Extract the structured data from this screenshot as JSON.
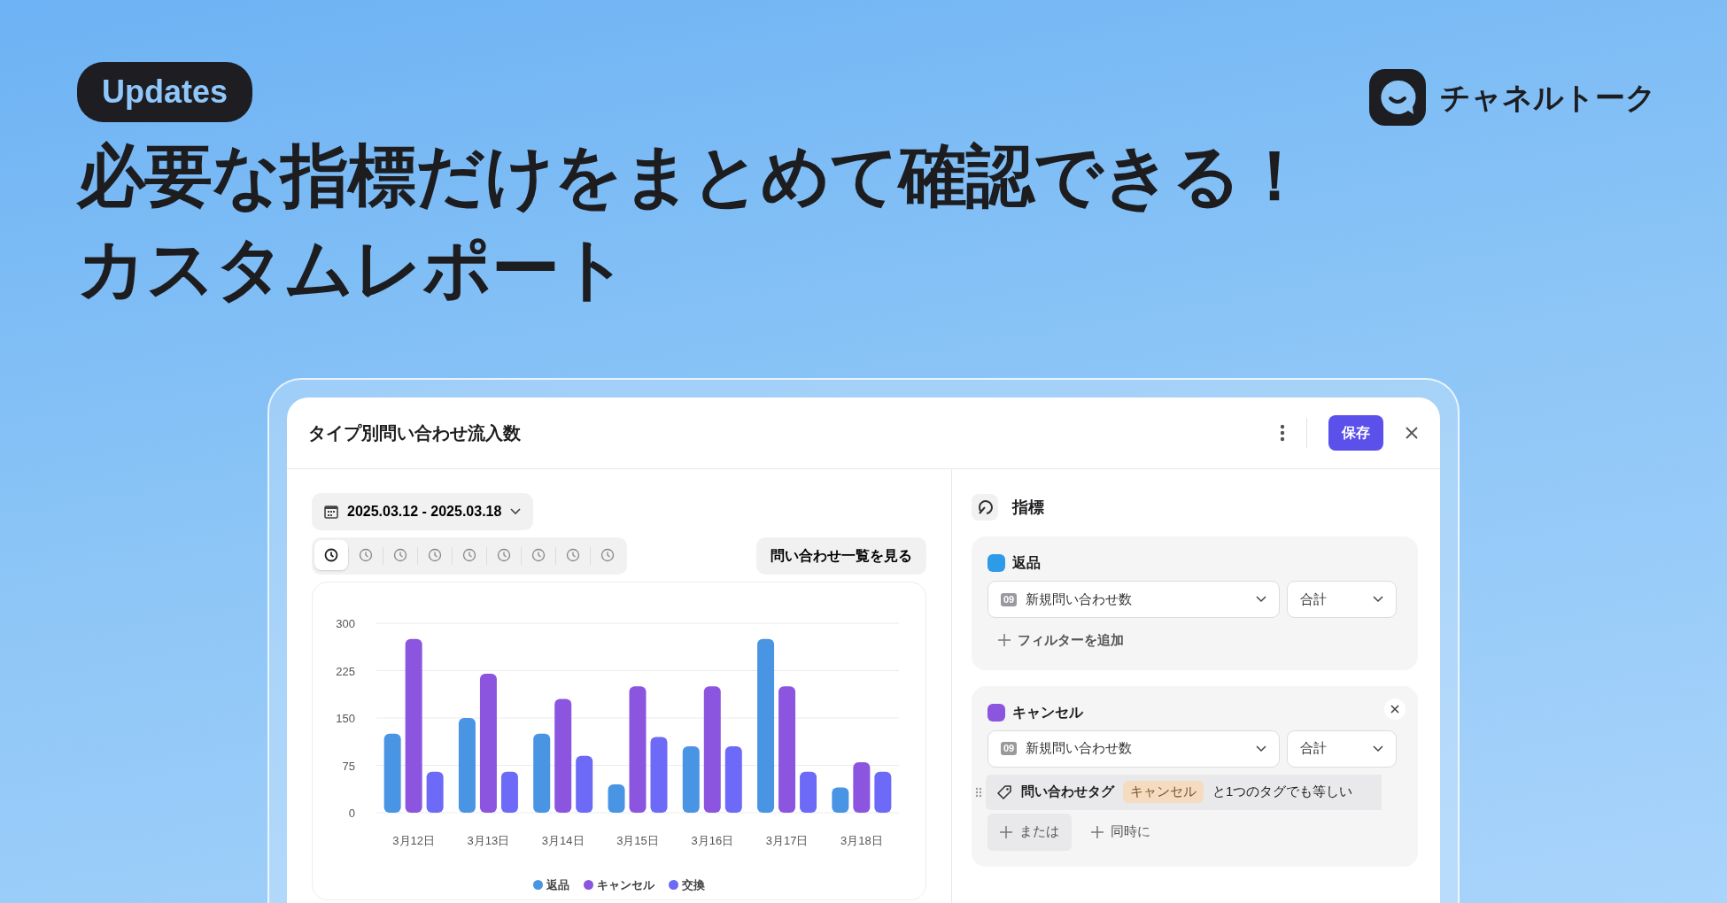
{
  "badge": "Updates",
  "headline": [
    "必要な指標だけをまとめて確認できる！",
    "カスタムレポート"
  ],
  "logo": {
    "text": "チャネルトーク"
  },
  "report": {
    "title": "タイプ別問い合わせ流入数",
    "save_button": "保存",
    "date_range": "2025.03.12 - 2025.03.18",
    "time_buttons": [
      {
        "selected": true
      },
      {
        "selected": false
      },
      {
        "selected": false
      },
      {
        "selected": false
      },
      {
        "selected": false
      },
      {
        "selected": false
      },
      {
        "selected": false
      },
      {
        "selected": false
      },
      {
        "selected": false
      }
    ],
    "list_button": "問い合わせ一覧を見る",
    "chart_data": {
      "type": "bar",
      "categories": [
        "3月12日",
        "3月13日",
        "3月14日",
        "3月15日",
        "3月16日",
        "3月17日",
        "3月18日"
      ],
      "series": [
        {
          "name": "返品",
          "color": "#4a94e4",
          "values": [
            125,
            150,
            125,
            45,
            105,
            275,
            40
          ]
        },
        {
          "name": "キャンセル",
          "color": "#8b55e0",
          "values": [
            275,
            220,
            180,
            200,
            200,
            200,
            80
          ]
        },
        {
          "name": "交換",
          "color": "#6c6af6",
          "values": [
            65,
            65,
            90,
            120,
            105,
            65,
            65
          ]
        }
      ],
      "ylim": [
        0,
        300
      ],
      "yticks": [
        0,
        75,
        150,
        225,
        300
      ],
      "grid": true,
      "legend": "bottom"
    }
  },
  "metrics_panel": {
    "title": "指標",
    "metrics": [
      {
        "name": "返品",
        "color": "#2d9be8",
        "removable": false,
        "badge": "09",
        "field": "新規問い合わせ数",
        "aggregate": "合計",
        "add_filter": "フィルターを追加"
      },
      {
        "name": "キャンセル",
        "color": "#8b55e0",
        "removable": true,
        "badge": "09",
        "field": "新規問い合わせ数",
        "aggregate": "合計",
        "filter": {
          "label": "問い合わせタグ",
          "chip": "キャンセル",
          "condition": "と1つのタグでも等しい"
        },
        "or_button": "または",
        "and_button": "同時に"
      }
    ]
  }
}
